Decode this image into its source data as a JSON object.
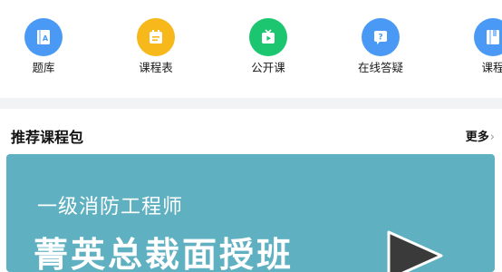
{
  "quick_nav": {
    "items": [
      {
        "label": "题库",
        "icon": "question-bank-icon",
        "color": "#4a9af5"
      },
      {
        "label": "课程表",
        "icon": "schedule-icon",
        "color": "#f6b81b"
      },
      {
        "label": "公开课",
        "icon": "open-class-tv-icon",
        "color": "#1cc56f"
      },
      {
        "label": "在线答疑",
        "icon": "qa-bubble-icon",
        "color": "#4a9af5"
      },
      {
        "label": "课程",
        "icon": "course-book-icon",
        "color": "#4a9af5"
      }
    ]
  },
  "recommended": {
    "title": "推荐课程包",
    "more_label": "更多",
    "more_chevron": "›"
  },
  "banner": {
    "subtitle": "一级消防工程师",
    "title": "菁英总裁面授班",
    "background": "#5fb0c0"
  }
}
